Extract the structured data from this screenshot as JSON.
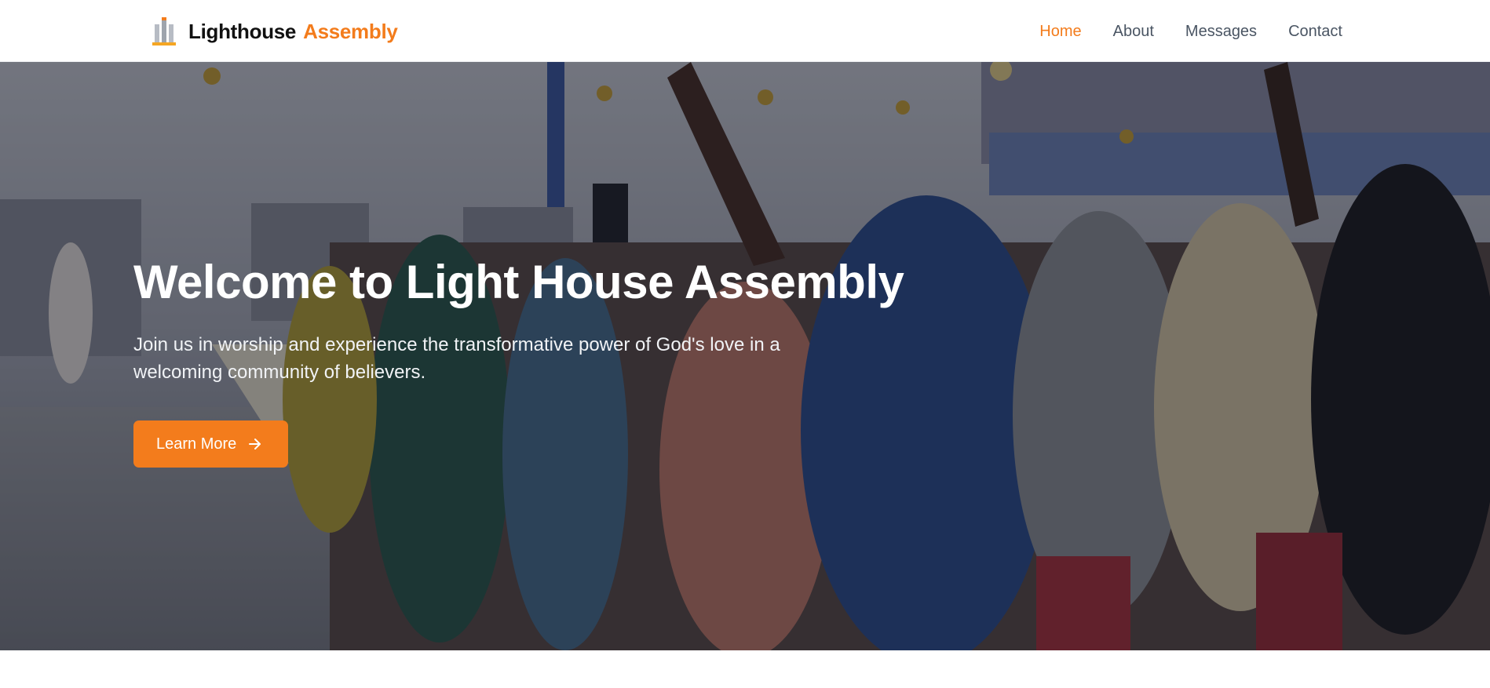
{
  "navbar": {
    "brand": {
      "name": "Lighthouse",
      "accent": "Assembly",
      "logo_icon": "lighthouse-pillars-icon"
    },
    "links": [
      {
        "label": "Home",
        "active": true
      },
      {
        "label": "About",
        "active": false
      },
      {
        "label": "Messages",
        "active": false
      },
      {
        "label": "Contact",
        "active": false
      }
    ]
  },
  "hero": {
    "title": "Welcome to Light House Assembly",
    "subtitle": "Join us in worship and experience the transformative power of God's love in a welcoming community of believers.",
    "cta": {
      "label": "Learn More",
      "icon": "arrow-right-icon"
    }
  },
  "colors": {
    "accent": "#f37c1c",
    "nav_text": "#4a5563",
    "brand_text": "#111111",
    "hero_text": "#ffffff"
  }
}
